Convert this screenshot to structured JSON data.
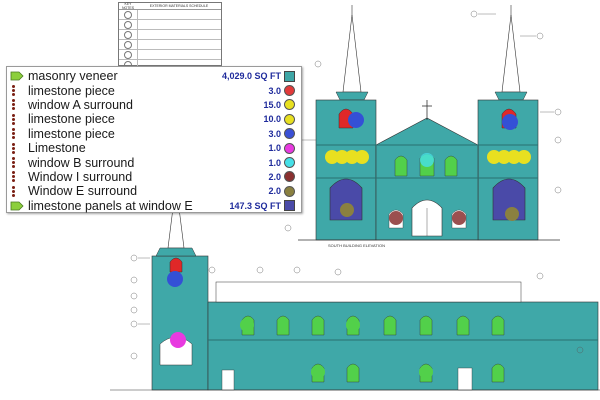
{
  "legend": {
    "items": [
      {
        "label": "masonry veneer",
        "qty": "4,029.0 SQ FT",
        "icon": "polygon-area-icon",
        "color": "#3ea6a6"
      },
      {
        "label": "limestone piece",
        "qty": "3.0",
        "icon": "count-dots-icon",
        "color": "#e23a3a"
      },
      {
        "label": "window A surround",
        "qty": "15.0",
        "icon": "count-dots-icon",
        "color": "#e8e020"
      },
      {
        "label": "limestone piece",
        "qty": "10.0",
        "icon": "count-dots-icon",
        "color": "#e8e020"
      },
      {
        "label": "limestone piece",
        "qty": "3.0",
        "icon": "count-dots-icon",
        "color": "#3a50d6"
      },
      {
        "label": "Limestone",
        "qty": "1.0",
        "icon": "count-dots-icon",
        "color": "#e83ae0"
      },
      {
        "label": "window B surround",
        "qty": "1.0",
        "icon": "count-dots-icon",
        "color": "#46e0e8"
      },
      {
        "label": "Window I surround",
        "qty": "2.0",
        "icon": "count-dots-icon",
        "color": "#8a3030"
      },
      {
        "label": "Window E surround",
        "qty": "2.0",
        "icon": "count-dots-icon",
        "color": "#8a8040"
      },
      {
        "label": "limestone panels at window E",
        "qty": "147.3 SQ FT",
        "icon": "polygon-area-icon",
        "color": "#4a4aa8"
      }
    ]
  },
  "schedule": {
    "headers": [
      "KEY NOTES",
      "EXTERIOR MATERIALS SCHEDULE"
    ],
    "numbers": [
      "1",
      "2",
      "3",
      "4",
      "5",
      "6"
    ]
  },
  "drawing": {
    "south_elevation_title": "SOUTH BUILDING ELEVATION"
  }
}
